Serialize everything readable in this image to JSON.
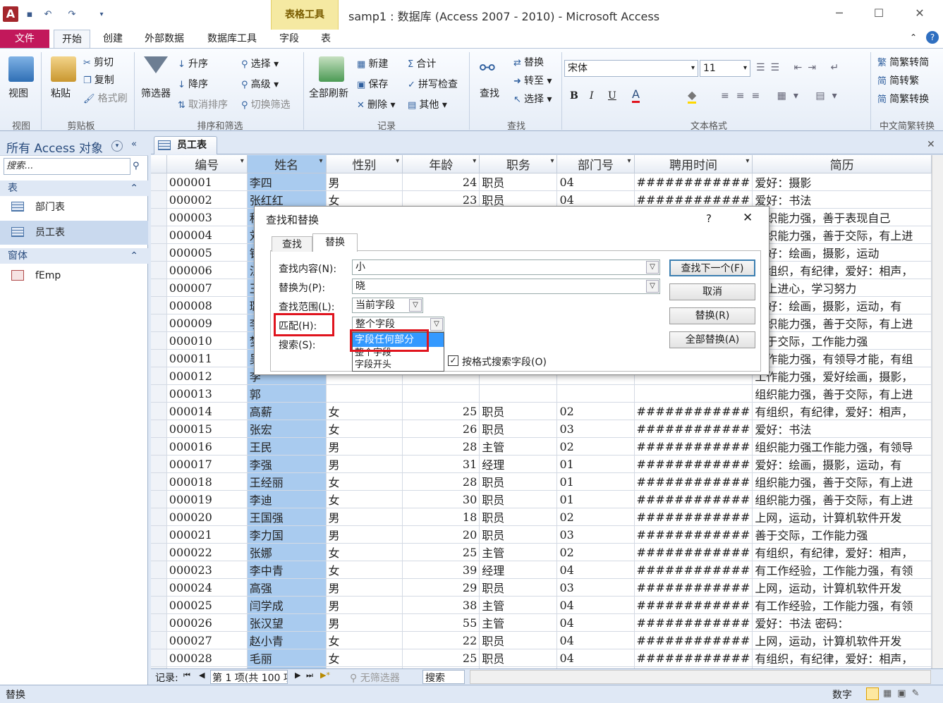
{
  "titlebar": {
    "app_letter": "A",
    "title": "samp1 : 数据库 (Access 2007 - 2010)  -  Microsoft Access",
    "context_group": "表格工具",
    "undo": "↶",
    "redo": "↷",
    "minimize": "─",
    "maximize": "☐",
    "close": "✕"
  },
  "tabs": {
    "file": "文件",
    "home": "开始",
    "create": "创建",
    "external": "外部数据",
    "dbtools": "数据库工具",
    "field": "字段",
    "table": "表"
  },
  "ribbon": {
    "view": "视图",
    "paste": "粘贴",
    "cut": "剪切",
    "copy": "复制",
    "format_painter": "格式刷",
    "filter": "筛选器",
    "asc": "升序",
    "desc": "降序",
    "remove_sort": "取消排序",
    "selection": "选择",
    "advanced": "高级",
    "toggle_filter": "切换筛选",
    "refresh_all": "全部刷新",
    "new": "新建",
    "save": "保存",
    "delete": "删除",
    "totals": "合计",
    "spelling": "拼写检查",
    "more": "其他",
    "find": "查找",
    "replace": "替换",
    "goto": "转至",
    "select": "选择",
    "font": "宋体",
    "size": "11",
    "bold": "B",
    "italic": "I",
    "underline": "U",
    "to_trad": "简繁转简",
    "to_simp": "简转繁",
    "convert": "简繁转换",
    "groups": {
      "views": "视图",
      "clipboard": "剪贴板",
      "sort": "排序和筛选",
      "records": "记录",
      "find": "查找",
      "textfmt": "文本格式",
      "conv": "中文简繁转换"
    }
  },
  "nav": {
    "title": "所有 Access 对象",
    "search": "搜索...",
    "sec_tables": "表",
    "item_dept": "部门表",
    "item_emp": "员工表",
    "sec_forms": "窗体",
    "item_form": "fEmp"
  },
  "doc": {
    "tab": "员工表"
  },
  "grid": {
    "columns": [
      "编号",
      "姓名",
      "性别",
      "年龄",
      "职务",
      "部门号",
      "聘用时间",
      "简历"
    ],
    "hash": "############",
    "rows": [
      [
        "000001",
        "李四",
        "男",
        "24",
        "职员",
        "04",
        "爱好：摄影"
      ],
      [
        "000002",
        "张红红",
        "女",
        "23",
        "职员",
        "04",
        "爱好：书法"
      ],
      [
        "000003",
        "程",
        "",
        "",
        "",
        "",
        "组织能力强，善于表现自己"
      ],
      [
        "000004",
        "刘",
        "",
        "",
        "",
        "",
        "组织能力强，善于交际，有上进"
      ],
      [
        "000005",
        "钟",
        "",
        "",
        "",
        "",
        "爱好：绘画，摄影，运动"
      ],
      [
        "000006",
        "江",
        "",
        "",
        "",
        "",
        "有组织，有纪律，爱好：相声，"
      ],
      [
        "000007",
        "王",
        "",
        "",
        "",
        "",
        "有上进心，学习努力"
      ],
      [
        "000008",
        "璐",
        "",
        "",
        "",
        "",
        "爱好：绘画，摄影，运动，有"
      ],
      [
        "000009",
        "李",
        "",
        "",
        "",
        "",
        "组织能力强，善于交际，有上进"
      ],
      [
        "000010",
        "梦",
        "",
        "",
        "",
        "",
        "善于交际，工作能力强"
      ],
      [
        "000011",
        "吴",
        "",
        "",
        "",
        "",
        "工作能力强，有领导才能，有组"
      ],
      [
        "000012",
        "李",
        "",
        "",
        "",
        "",
        "工作能力强，爱好绘画，摄影，"
      ],
      [
        "000013",
        "郭",
        "",
        "",
        "",
        "",
        "组织能力强，善于交际，有上进"
      ],
      [
        "000014",
        "高薪",
        "女",
        "25",
        "职员",
        "02",
        "有组织，有纪律，爱好：相声，"
      ],
      [
        "000015",
        "张宏",
        "女",
        "26",
        "职员",
        "03",
        "爱好：书法"
      ],
      [
        "000016",
        "王民",
        "男",
        "28",
        "主管",
        "02",
        "组织能力强工作能力强，有领导"
      ],
      [
        "000017",
        "李强",
        "男",
        "31",
        "经理",
        "01",
        "爱好：绘画，摄影，运动，有"
      ],
      [
        "000018",
        "王经丽",
        "女",
        "28",
        "职员",
        "01",
        "组织能力强，善于交际，有上进"
      ],
      [
        "000019",
        "李迪",
        "女",
        "30",
        "职员",
        "01",
        "组织能力强，善于交际，有上进"
      ],
      [
        "000020",
        "王国强",
        "男",
        "18",
        "职员",
        "02",
        "上网，运动，计算机软件开发"
      ],
      [
        "000021",
        "李力国",
        "男",
        "20",
        "职员",
        "03",
        "善于交际，工作能力强"
      ],
      [
        "000022",
        "张娜",
        "女",
        "25",
        "主管",
        "02",
        "有组织，有纪律，爱好：相声，"
      ],
      [
        "000023",
        "李中青",
        "女",
        "39",
        "经理",
        "04",
        "有工作经验，工作能力强，有领"
      ],
      [
        "000024",
        "高强",
        "男",
        "29",
        "职员",
        "03",
        "上网，运动，计算机软件开发"
      ],
      [
        "000025",
        "闫学成",
        "男",
        "38",
        "主管",
        "04",
        "有工作经验，工作能力强，有领"
      ],
      [
        "000026",
        "张汉望",
        "男",
        "55",
        "主管",
        "04",
        "爱好：书法 密码："
      ],
      [
        "000027",
        "赵小青",
        "女",
        "22",
        "职员",
        "04",
        "上网，运动，计算机软件开发"
      ],
      [
        "000028",
        "毛丽",
        "女",
        "25",
        "职员",
        "04",
        "有组织，有纪律，爱好：相声，"
      ],
      [
        "000029",
        "张小婉",
        "女",
        "28",
        "职员",
        "04",
        "爱好：绘画，摄影，运动，有"
      ],
      [
        "000030",
        "苏家强",
        "男",
        "30",
        "职员",
        "02",
        "爱好：书法"
      ],
      [
        "000031",
        "黄小红",
        "女",
        "26",
        "职员",
        "02",
        "上网，运动，计算机软件开发"
      ]
    ]
  },
  "recnav": {
    "label": "记录:",
    "first": "⏮",
    "prev": "◀",
    "pos": "第 1 项(共 100 项",
    "next": "▶",
    "last": "⏭",
    "new": "▶*",
    "nofilter": "无筛选器",
    "search": "搜索"
  },
  "status": {
    "left": "替换",
    "mode": "数字"
  },
  "dialog": {
    "title": "查找和替换",
    "help": "?",
    "close": "✕",
    "tab_find": "查找",
    "tab_replace": "替换",
    "find_label": "查找内容(N):",
    "find_value": "小",
    "replace_label": "替换为(P):",
    "replace_value": "晓",
    "scope_label": "查找范围(L):",
    "scope_value": "当前字段",
    "match_label": "匹配(H):",
    "match_value": "整个字段",
    "search_label": "搜索(S):",
    "options": [
      "字段任何部分",
      "整个字段",
      "字段开头"
    ],
    "format_check": "按格式搜索字段(O)",
    "btn_findnext": "查找下一个(F)",
    "btn_cancel": "取消",
    "btn_replace": "替换(R)",
    "btn_replaceall": "全部替换(A)"
  },
  "colors": {
    "file_tab": "#c2185b",
    "context_band": "#f5e9a2",
    "selected_col": "#a9cbef",
    "highlight_box": "#e0141e",
    "dropdown_selected": "#3399ff"
  }
}
